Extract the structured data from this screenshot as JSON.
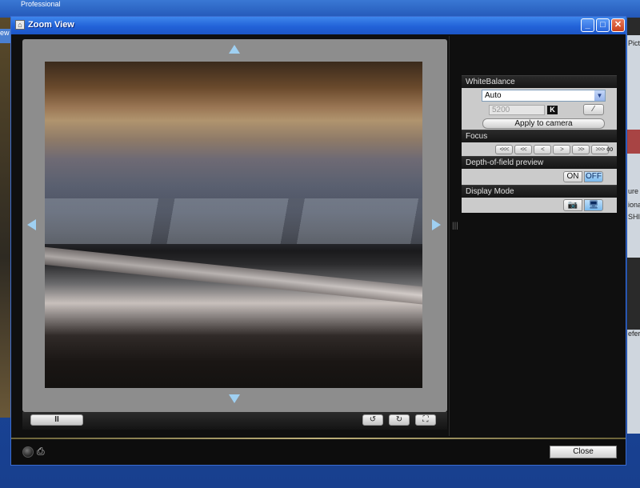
{
  "desktop": {
    "top_label": "Professional",
    "left_tab": "ew",
    "right_fragments": [
      "Pictu",
      "ure S",
      "iona",
      "SHI",
      "efere"
    ]
  },
  "window": {
    "title": "Zoom View",
    "minimize": "_",
    "maximize": "□",
    "close": "✕"
  },
  "viewer": {
    "pause_label": "II",
    "rotate_left_label": "↺",
    "rotate_right_label": "↻",
    "fit_label": "⛶"
  },
  "white_balance": {
    "header": "WhiteBalance",
    "mode_value": "Auto",
    "dropdown_arrow": "▼",
    "kelvin_value": "5200",
    "kelvin_unit": "K",
    "eyedropper_label": "⁄",
    "apply_label": "Apply to camera"
  },
  "focus": {
    "header": "Focus",
    "buttons": [
      "<<<",
      "<<",
      "<",
      ">",
      ">>",
      ">>>"
    ],
    "infinity_label": "∞"
  },
  "depth_of_field": {
    "header": "Depth-of-field preview",
    "on_label": "ON",
    "off_label": "OFF",
    "state": "OFF"
  },
  "display_mode": {
    "header": "Display Mode",
    "camera_label": "📷",
    "pc_label": "🖥",
    "selected": "pc"
  },
  "footer": {
    "close_label": "Close"
  },
  "icons": {
    "camera_status": "camera-status-icon",
    "camera_link": "camera-link-icon",
    "nav_arrows": "triangle-arrow-icon"
  },
  "colors": {
    "title_bar": "#2262d8",
    "panel_bg": "#cbcbcb",
    "selected_toggle": "#7ab8ec",
    "arrow": "#9fd0f2"
  }
}
